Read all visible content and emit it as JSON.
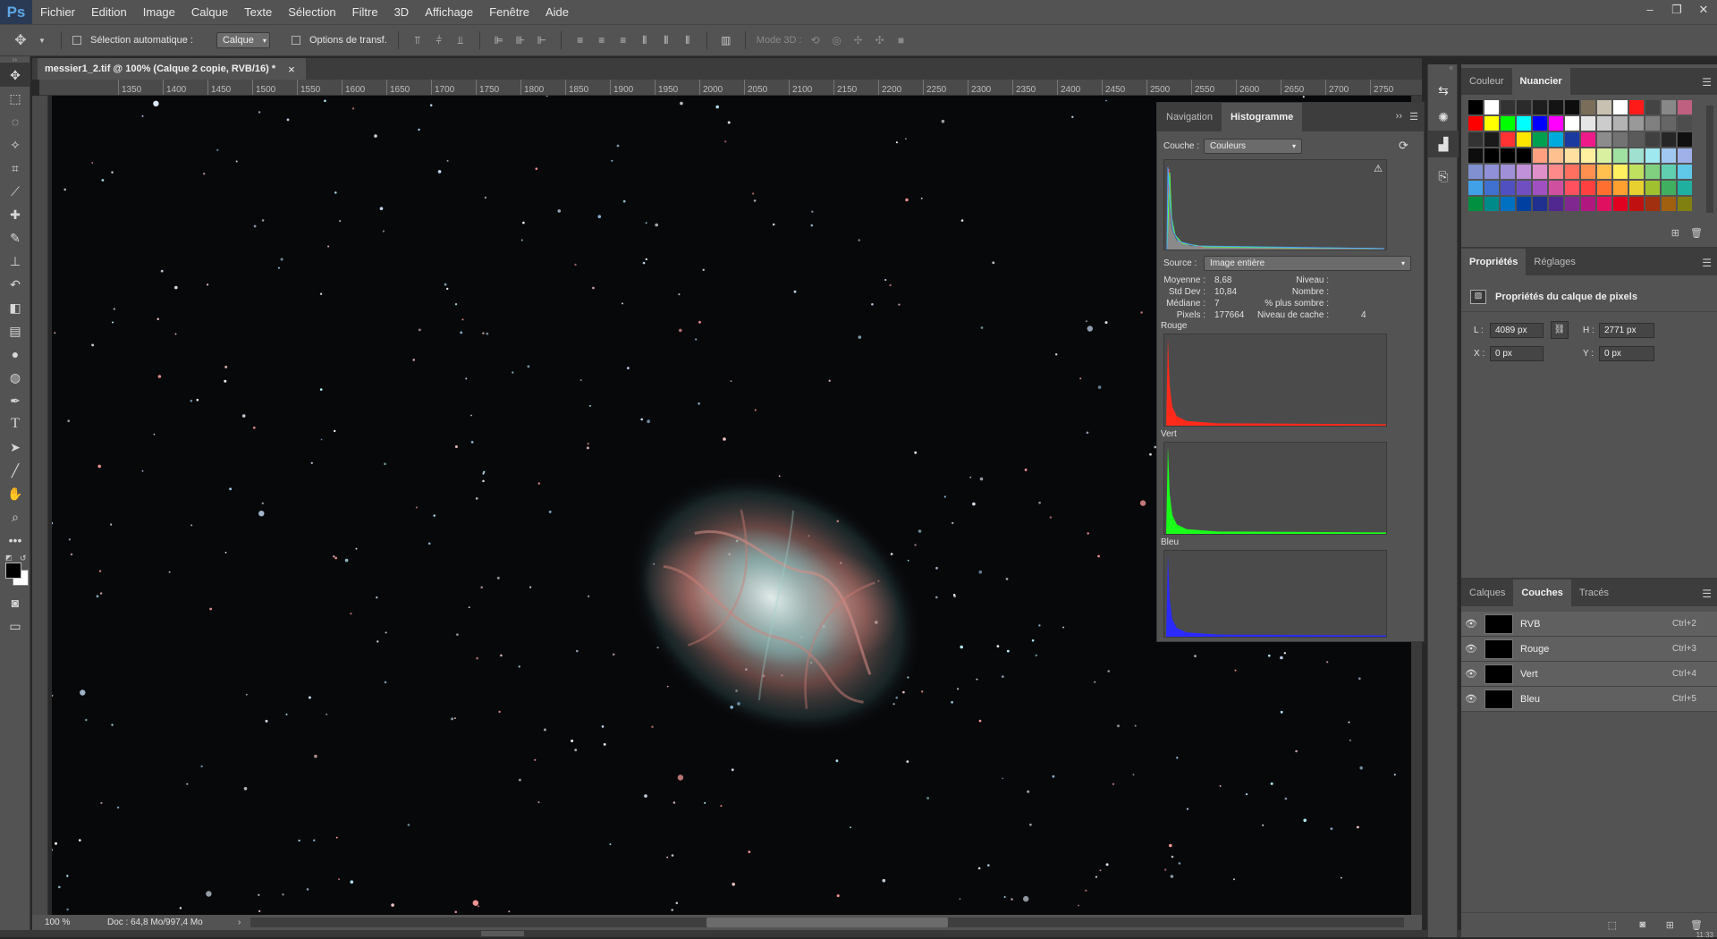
{
  "app": {
    "logo": "Ps",
    "menus": [
      "Fichier",
      "Edition",
      "Image",
      "Calque",
      "Texte",
      "Sélection",
      "Filtre",
      "3D",
      "Affichage",
      "Fenêtre",
      "Aide"
    ],
    "window_controls": [
      "–",
      "❐",
      "✕"
    ]
  },
  "options": {
    "auto_select_label": "Sélection automatique :",
    "auto_select_value": "Calque",
    "transform_label": "Options de transf.",
    "mode3d_label": "Mode 3D :"
  },
  "document": {
    "tab_title": "messier1_2.tif @ 100% (Calque 2 copie, RVB/16) *",
    "close": "×",
    "zoom": "100 %",
    "doc_size": "Doc : 64,8 Mo/997,4 Mo"
  },
  "ruler": {
    "h_ticks": [
      "1350",
      "1400",
      "1450",
      "1500",
      "1550",
      "1600",
      "1650",
      "1700",
      "1750",
      "1800",
      "1850",
      "1900",
      "1950",
      "2000",
      "2050",
      "2100",
      "2150",
      "2200",
      "2250",
      "2300",
      "2350",
      "2400",
      "2450",
      "2500",
      "2550",
      "2600",
      "2650",
      "2700",
      "2750"
    ]
  },
  "histogram": {
    "tabs": [
      "Navigation",
      "Histogramme"
    ],
    "channel_label": "Couche :",
    "channel_value": "Couleurs",
    "source_label": "Source :",
    "source_value": "Image entière",
    "stats": {
      "moyenne_l": "Moyenne :",
      "moyenne": "8,68",
      "stddev_l": "Std Dev :",
      "stddev": "10,84",
      "mediane_l": "Médiane :",
      "mediane": "7",
      "pixels_l": "Pixels :",
      "pixels": "177664",
      "niveau_l": "Niveau :",
      "nombre_l": "Nombre :",
      "sombre_l": "% plus sombre :",
      "cache_l": "Niveau de cache :",
      "cache": "4"
    },
    "rouge": "Rouge",
    "vert": "Vert",
    "bleu": "Bleu",
    "colors": {
      "red": "#ff2a1a",
      "green": "#1aff1a",
      "blue": "#2a2aff"
    }
  },
  "swatches": {
    "tabs": [
      "Couleur",
      "Nuancier"
    ]
  },
  "properties": {
    "tabs": [
      "Propriétés",
      "Réglages"
    ],
    "title": "Propriétés du calque de pixels",
    "w_label": "L :",
    "w": "4089 px",
    "h_label": "H :",
    "h": "2771 px",
    "x_label": "X :",
    "x": "0 px",
    "y_label": "Y :",
    "y": "0 px"
  },
  "layers": {
    "tabs": [
      "Calques",
      "Couches",
      "Tracés"
    ],
    "channels": [
      {
        "name": "RVB",
        "shortcut": "Ctrl+2"
      },
      {
        "name": "Rouge",
        "shortcut": "Ctrl+3"
      },
      {
        "name": "Vert",
        "shortcut": "Ctrl+4"
      },
      {
        "name": "Bleu",
        "shortcut": "Ctrl+5"
      }
    ]
  },
  "clock": "11:33"
}
